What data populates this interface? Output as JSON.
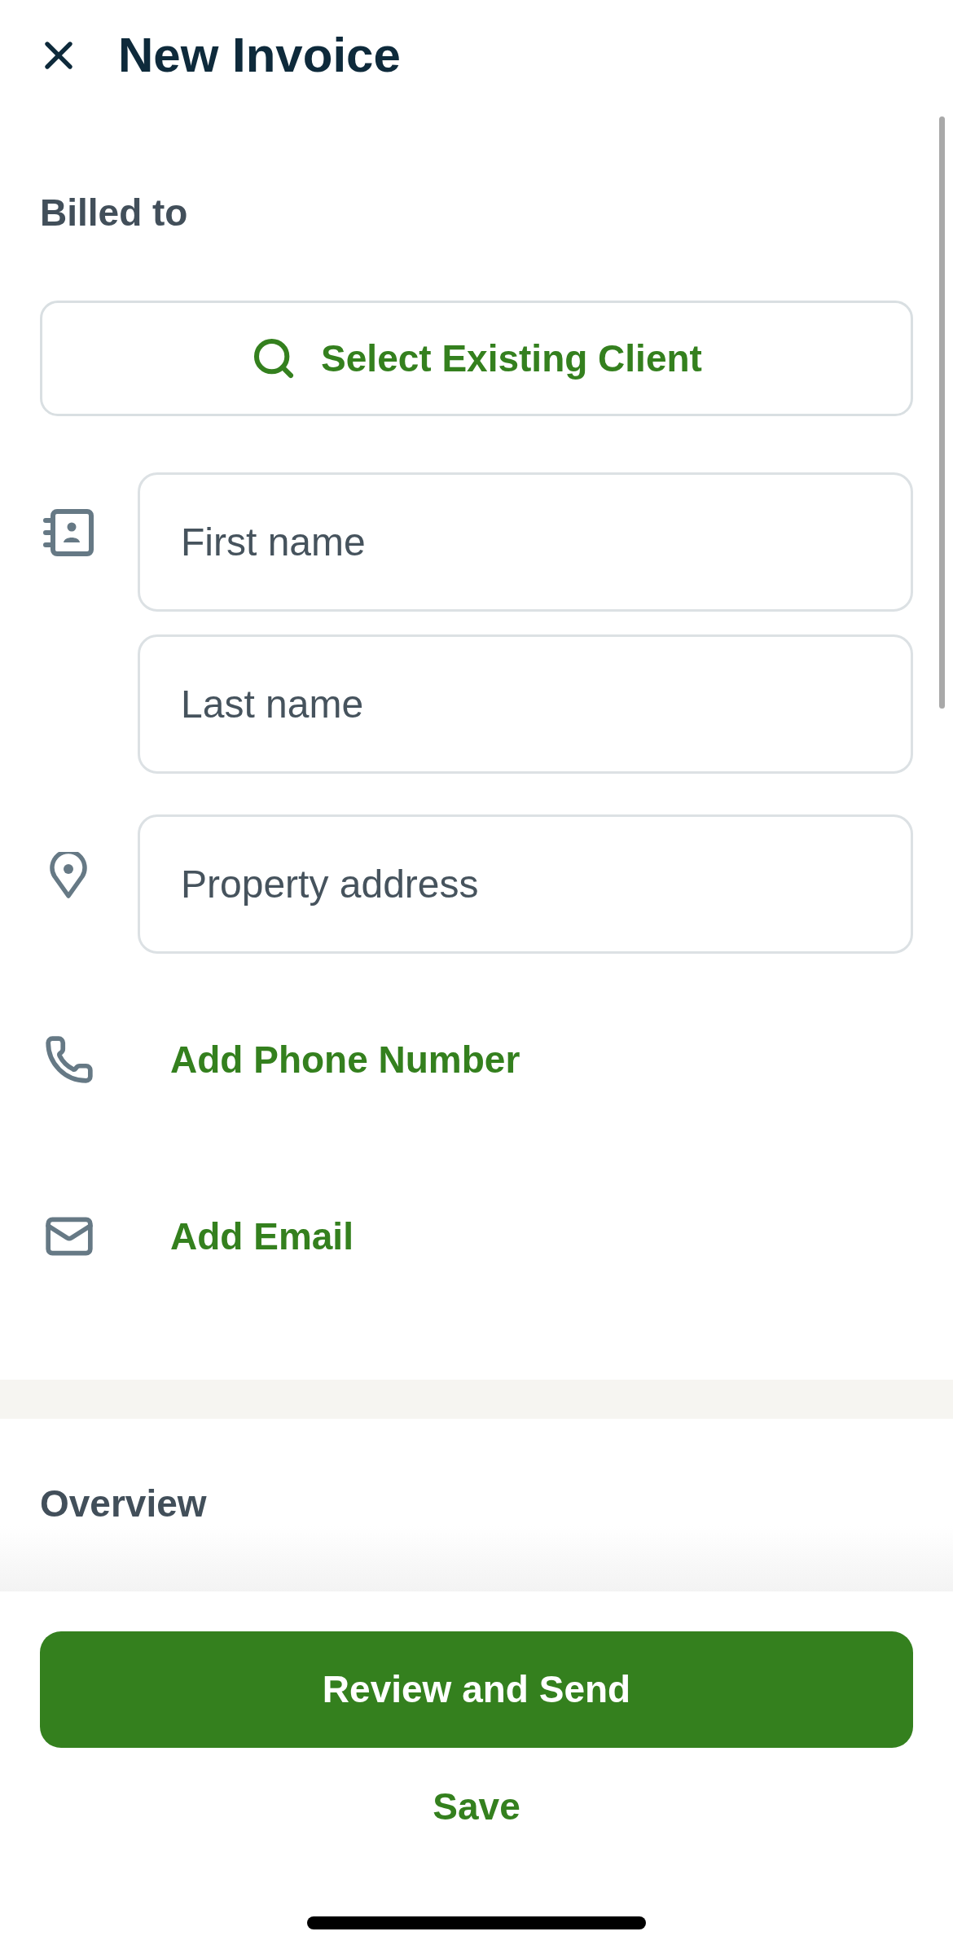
{
  "header": {
    "title": "New Invoice"
  },
  "billed_to": {
    "heading": "Billed to",
    "select_client_button": "Select Existing Client",
    "fields": [
      {
        "kind": "contact",
        "placeholder": "First name"
      },
      {
        "kind": "plain",
        "placeholder": "Last name"
      },
      {
        "kind": "location",
        "placeholder": "Property address"
      }
    ],
    "actions": [
      {
        "kind": "phone",
        "label": "Add Phone Number"
      },
      {
        "kind": "email",
        "label": "Add Email"
      }
    ]
  },
  "overview": {
    "heading": "Overview"
  },
  "footer": {
    "primary_button": "Review and Send",
    "secondary_button": "Save"
  }
}
